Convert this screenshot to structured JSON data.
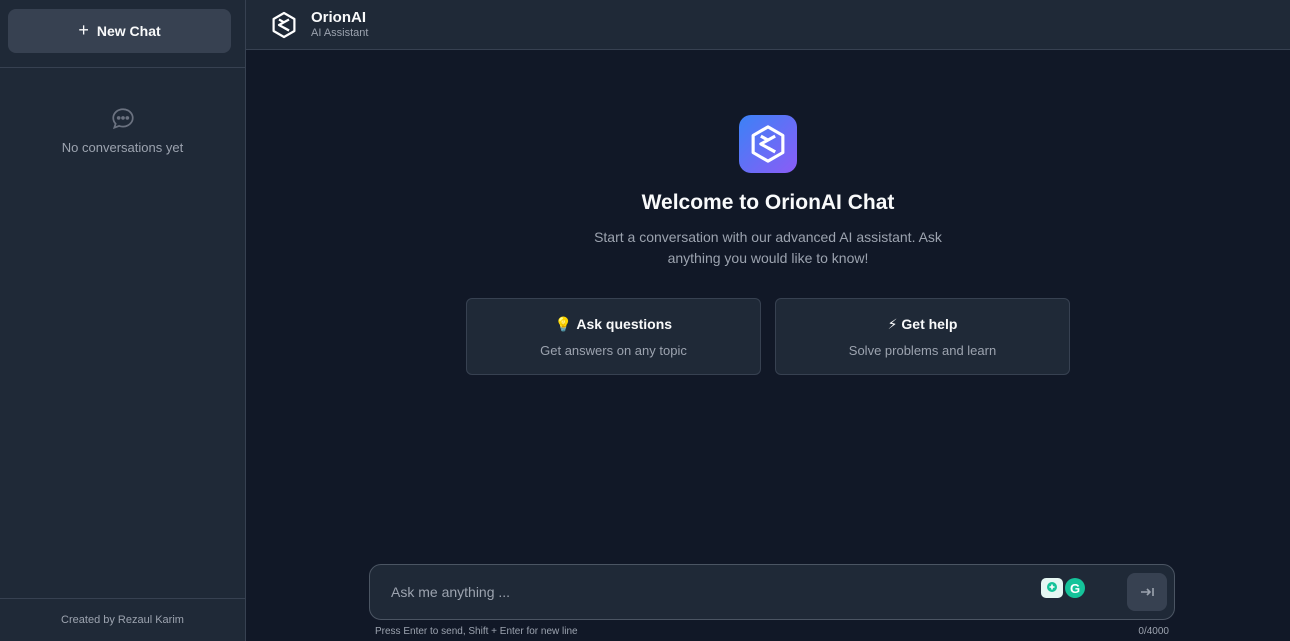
{
  "sidebar": {
    "new_chat_label": "New Chat",
    "empty_text": "No conversations yet",
    "footer": "Created by Rezaul Karim"
  },
  "header": {
    "title": "OrionAI",
    "subtitle": "AI Assistant"
  },
  "welcome": {
    "title": "Welcome to OrionAI Chat",
    "description": "Start a conversation with our advanced AI assistant. Ask anything you would like to know!"
  },
  "cards": [
    {
      "icon": "💡",
      "title": "Ask questions",
      "desc": "Get answers on any topic"
    },
    {
      "icon": "⚡",
      "title": "Get help",
      "desc": "Solve problems and learn"
    }
  ],
  "input": {
    "placeholder": "Ask me anything ...",
    "hint": "Press Enter to send, Shift + Enter for new line",
    "counter": "0/4000"
  },
  "icons": {
    "new_chat": "plus-icon",
    "empty": "chat-bubble-icon",
    "send": "send-icon",
    "extension_grammar": "grammarly-icon"
  },
  "colors": {
    "background": "#111827",
    "panel": "#1f2937",
    "border": "#374151",
    "accent_start": "#3b82f6",
    "accent_end": "#8b5cf6"
  }
}
